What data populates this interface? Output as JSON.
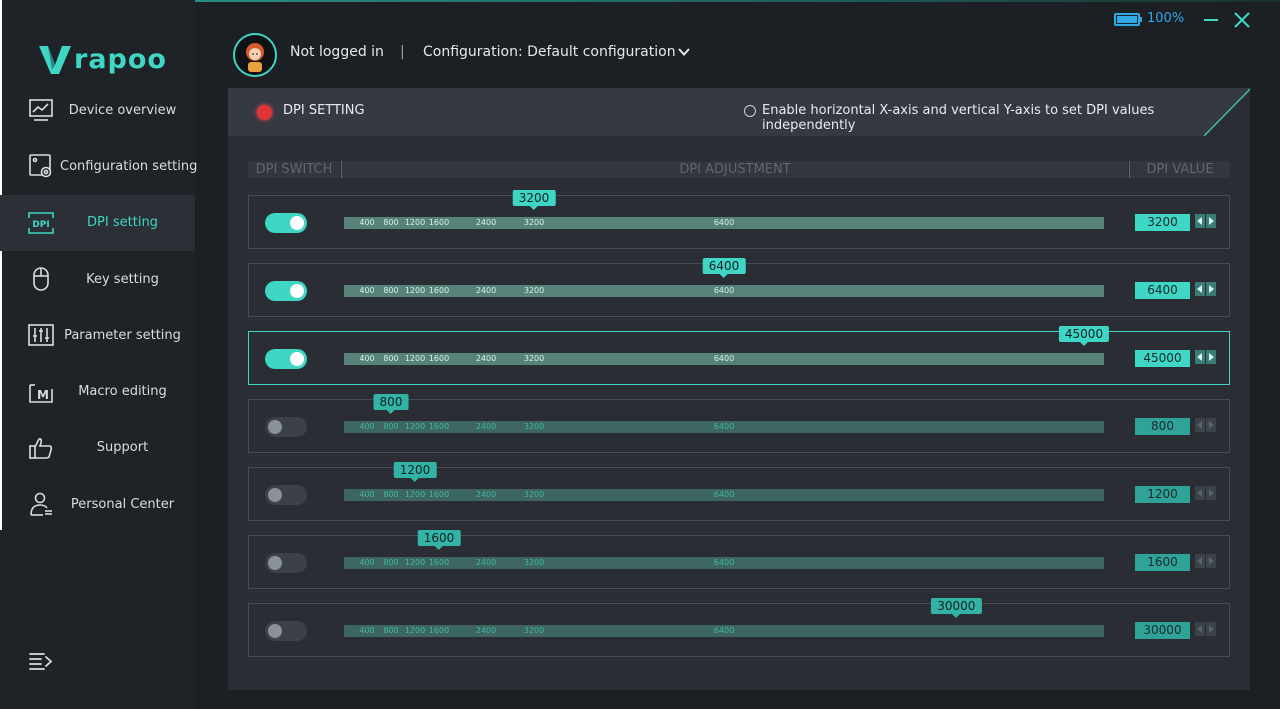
{
  "brand": {
    "logo_text": "rapoo",
    "accent": "#3fd6c6"
  },
  "sidebar": {
    "items": [
      {
        "label": "Device overview",
        "icon": "chart-icon",
        "active": false
      },
      {
        "label": "Configuration setting",
        "icon": "config-gear-icon",
        "active": false
      },
      {
        "label": "DPI setting",
        "icon": "dpi-icon",
        "active": true
      },
      {
        "label": "Key setting",
        "icon": "mouse-icon",
        "active": false
      },
      {
        "label": "Parameter setting",
        "icon": "sliders-icon",
        "active": false
      },
      {
        "label": "Macro editing",
        "icon": "macro-icon",
        "active": false
      },
      {
        "label": "Support",
        "icon": "thumbs-up-icon",
        "active": false
      },
      {
        "label": "Personal Center",
        "icon": "user-icon",
        "active": false
      }
    ],
    "collapse_icon": "menu-collapse-icon"
  },
  "header": {
    "user_status": "Not logged in",
    "separator": "|",
    "configuration": "Configuration: Default configuration",
    "battery_percent": "100%",
    "battery_level": 1.0
  },
  "panel": {
    "title": "DPI SETTING",
    "independent_xy_label": "Enable horizontal X-axis and vertical Y-axis to set DPI values independently",
    "columns": {
      "switch": "DPI SWITCH",
      "adjustment": "DPI ADJUSTMENT",
      "value": "DPI VALUE"
    },
    "ticks": [
      "400",
      "800",
      "1200",
      "1600",
      "2400",
      "3200",
      "6400"
    ],
    "rows": [
      {
        "enabled": true,
        "value": "3200",
        "selected": false
      },
      {
        "enabled": true,
        "value": "6400",
        "selected": false
      },
      {
        "enabled": true,
        "value": "45000",
        "selected": true
      },
      {
        "enabled": false,
        "value": "800",
        "selected": false
      },
      {
        "enabled": false,
        "value": "1200",
        "selected": false
      },
      {
        "enabled": false,
        "value": "1600",
        "selected": false
      },
      {
        "enabled": false,
        "value": "30000",
        "selected": false
      }
    ]
  }
}
